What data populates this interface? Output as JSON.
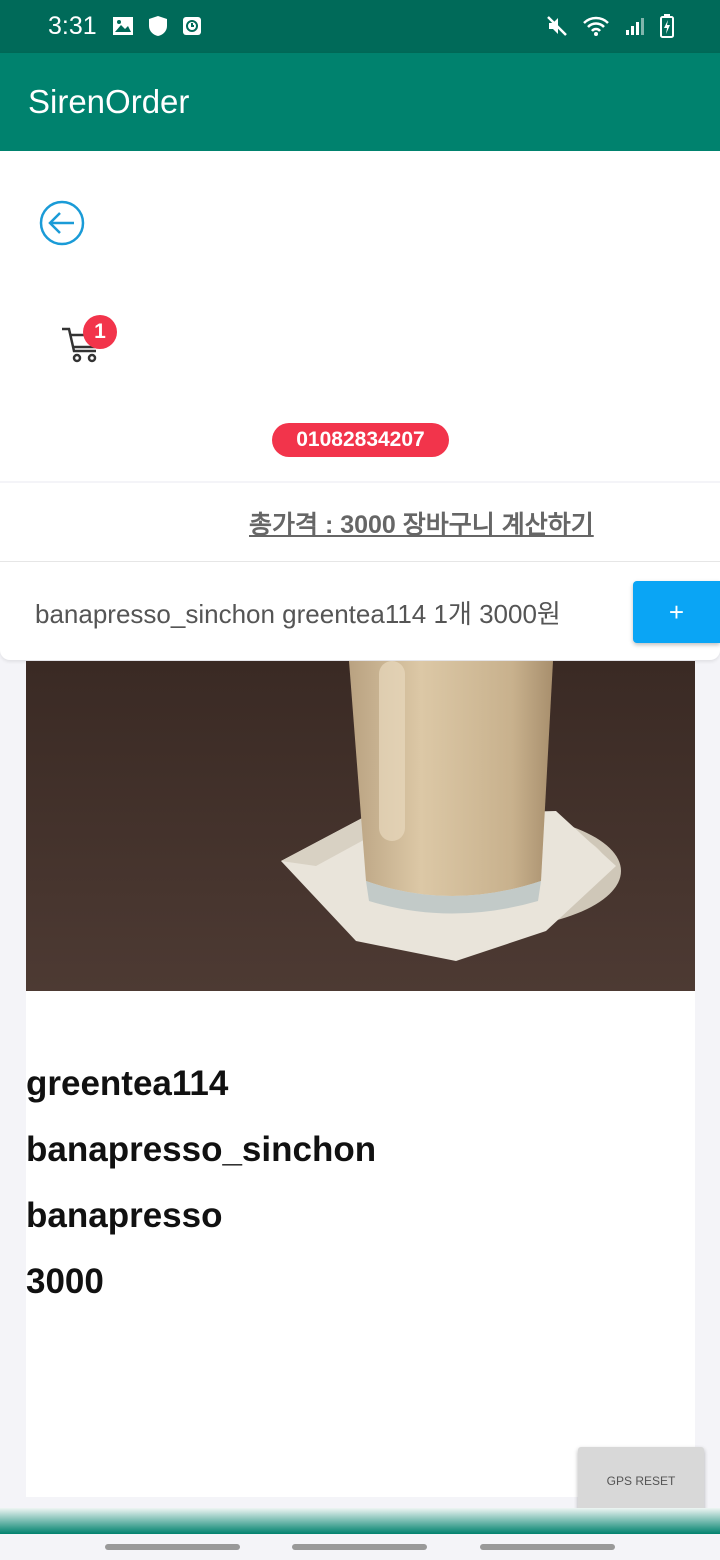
{
  "status_bar": {
    "time": "3:31"
  },
  "app_bar": {
    "title": "SirenOrder"
  },
  "header": {
    "cart_count": "1",
    "phone": "01082834207"
  },
  "cart_summary": {
    "total_label": "총가격 : 3000 장바구니 계산하기"
  },
  "cart_item": {
    "text": "banapresso_sinchon greentea114 1개 3000원",
    "add_label": "+"
  },
  "product": {
    "name": "greentea114",
    "store": "banapresso_sinchon",
    "brand": "banapresso",
    "price": "3000"
  },
  "gps_button": {
    "label": "GPS RESET"
  },
  "colors": {
    "status_bar": "#006a59",
    "app_bar": "#00826e",
    "badge": "#f2344b",
    "add_button": "#0aa5f5",
    "back_icon": "#1a9bd7"
  }
}
